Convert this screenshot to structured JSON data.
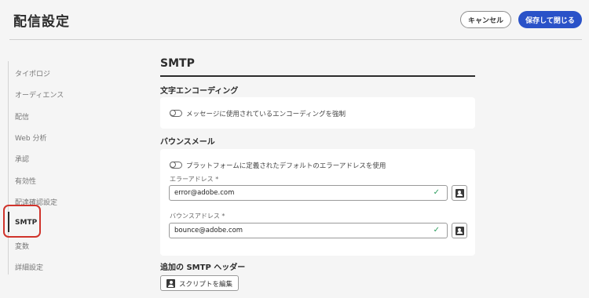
{
  "header": {
    "title": "配信設定",
    "cancel_label": "キャンセル",
    "save_label": "保存して閉じる"
  },
  "sidebar": {
    "items": [
      {
        "label": "タイポロジ"
      },
      {
        "label": "オーディエンス"
      },
      {
        "label": "配信"
      },
      {
        "label": "Web 分析"
      },
      {
        "label": "承認"
      },
      {
        "label": "有効性"
      },
      {
        "label": "配達確認設定"
      },
      {
        "label": "SMTP"
      },
      {
        "label": "変数"
      },
      {
        "label": "詳細設定"
      }
    ],
    "active_index": 7
  },
  "main": {
    "section_title": "SMTP",
    "encoding": {
      "heading": "文字エンコーディング",
      "toggle_label": "メッセージに使用されているエンコーディングを強制",
      "toggle_on": false
    },
    "bounce": {
      "heading": "バウンスメール",
      "toggle_label": "プラットフォームに定義されたデフォルトのエラーアドレスを使用",
      "toggle_on": false,
      "error_address": {
        "label": "エラーアドレス *",
        "value": "error@adobe.com"
      },
      "bounce_address": {
        "label": "バウンスアドレス *",
        "value": "bounce@adobe.com"
      }
    },
    "headers": {
      "heading": "追加の SMTP ヘッダー",
      "script_button_label": "スクリプトを編集"
    }
  },
  "colors": {
    "accent": "#2a52c8",
    "highlight": "#d0342c",
    "valid": "#2d9d5f"
  }
}
